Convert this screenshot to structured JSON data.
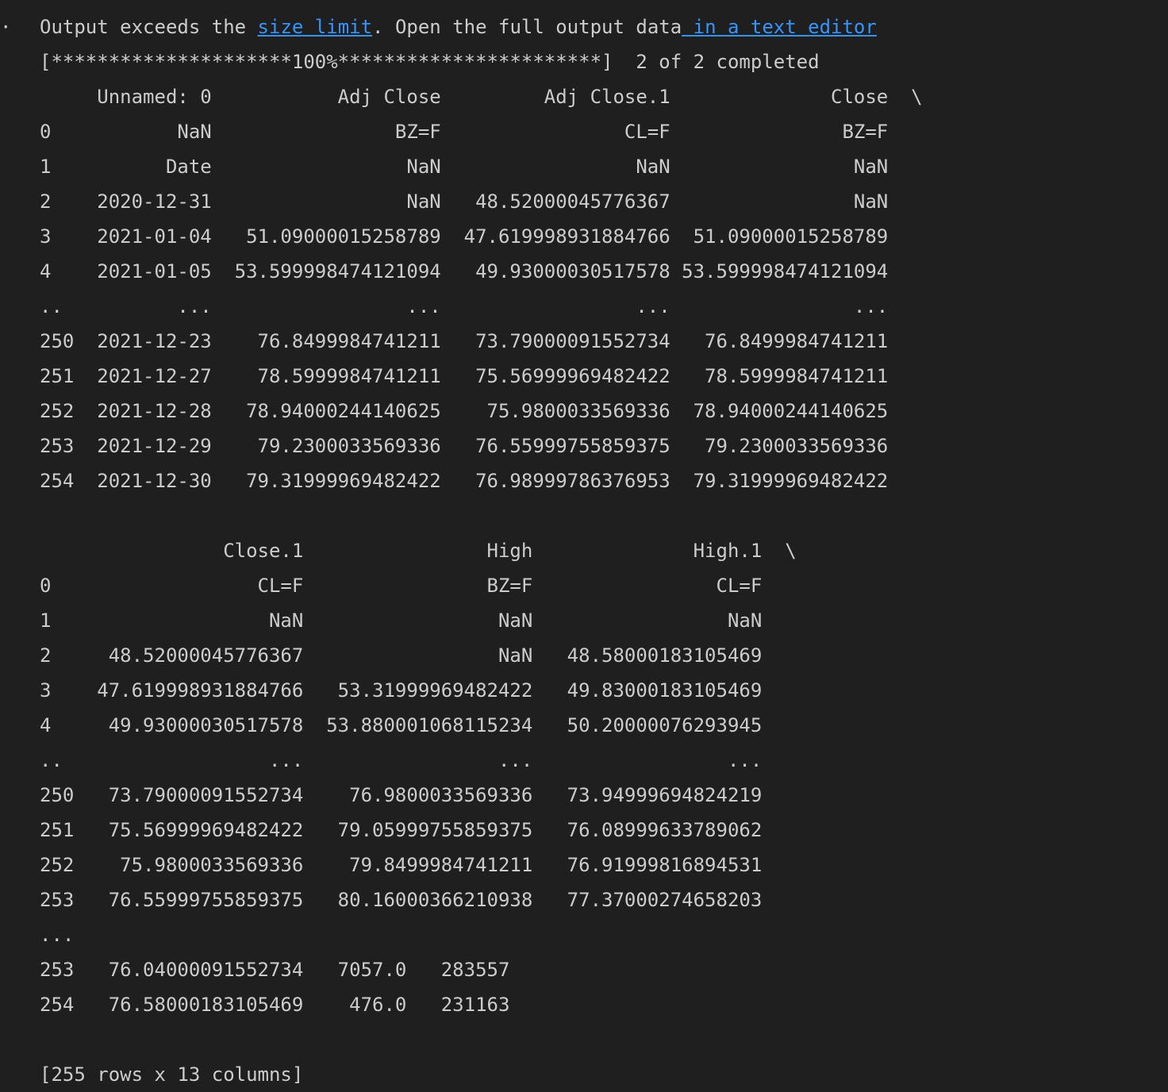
{
  "output": {
    "gutter_marker": "·",
    "notice": {
      "before": "Output exceeds the ",
      "link1": "size limit",
      "middle": ". Open the full output data",
      "link2": " in a text editor"
    },
    "lines": [
      "[*********************100%***********************]  2 of 2 completed",
      "     Unnamed: 0           Adj Close         Adj Close.1              Close  \\",
      "0           NaN                BZ=F                CL=F               BZ=F  ",
      "1          Date                 NaN                 NaN                NaN  ",
      "2    2020-12-31                 NaN   48.52000045776367                NaN  ",
      "3    2021-01-04   51.09000015258789  47.619998931884766  51.09000015258789  ",
      "4    2021-01-05  53.599998474121094   49.93000030517578 53.599998474121094  ",
      "..          ...                 ...                 ...                ...  ",
      "250  2021-12-23    76.8499984741211   73.79000091552734   76.8499984741211  ",
      "251  2021-12-27    78.5999984741211   75.56999969482422   78.5999984741211  ",
      "252  2021-12-28   78.94000244140625    75.9800033569336  78.94000244140625  ",
      "253  2021-12-29    79.2300033569336   76.55999755859375   79.2300033569336  ",
      "254  2021-12-30   79.31999969482422   76.98999786376953  79.31999969482422  ",
      "",
      "                Close.1                High              High.1  \\",
      "0                  CL=F                BZ=F                CL=F  ",
      "1                   NaN                 NaN                 NaN  ",
      "2     48.52000045776367                 NaN   48.58000183105469  ",
      "3    47.619998931884766   53.31999969482422   49.83000183105469  ",
      "4     49.93000030517578  53.880001068115234   50.20000076293945  ",
      "..                  ...                 ...                 ...  ",
      "250   73.79000091552734    76.9800033569336   73.94999694824219  ",
      "251   75.56999969482422   79.05999755859375   76.08999633789062  ",
      "252    75.9800033569336    79.8499984741211   76.91999816894531  ",
      "253   76.55999755859375   80.16000366210938   77.37000274658203  ",
      "...",
      "253   76.04000091552734   7057.0   283557  ",
      "254   76.58000183105469    476.0   231163  ",
      "",
      "[255 rows x 13 columns]"
    ]
  }
}
